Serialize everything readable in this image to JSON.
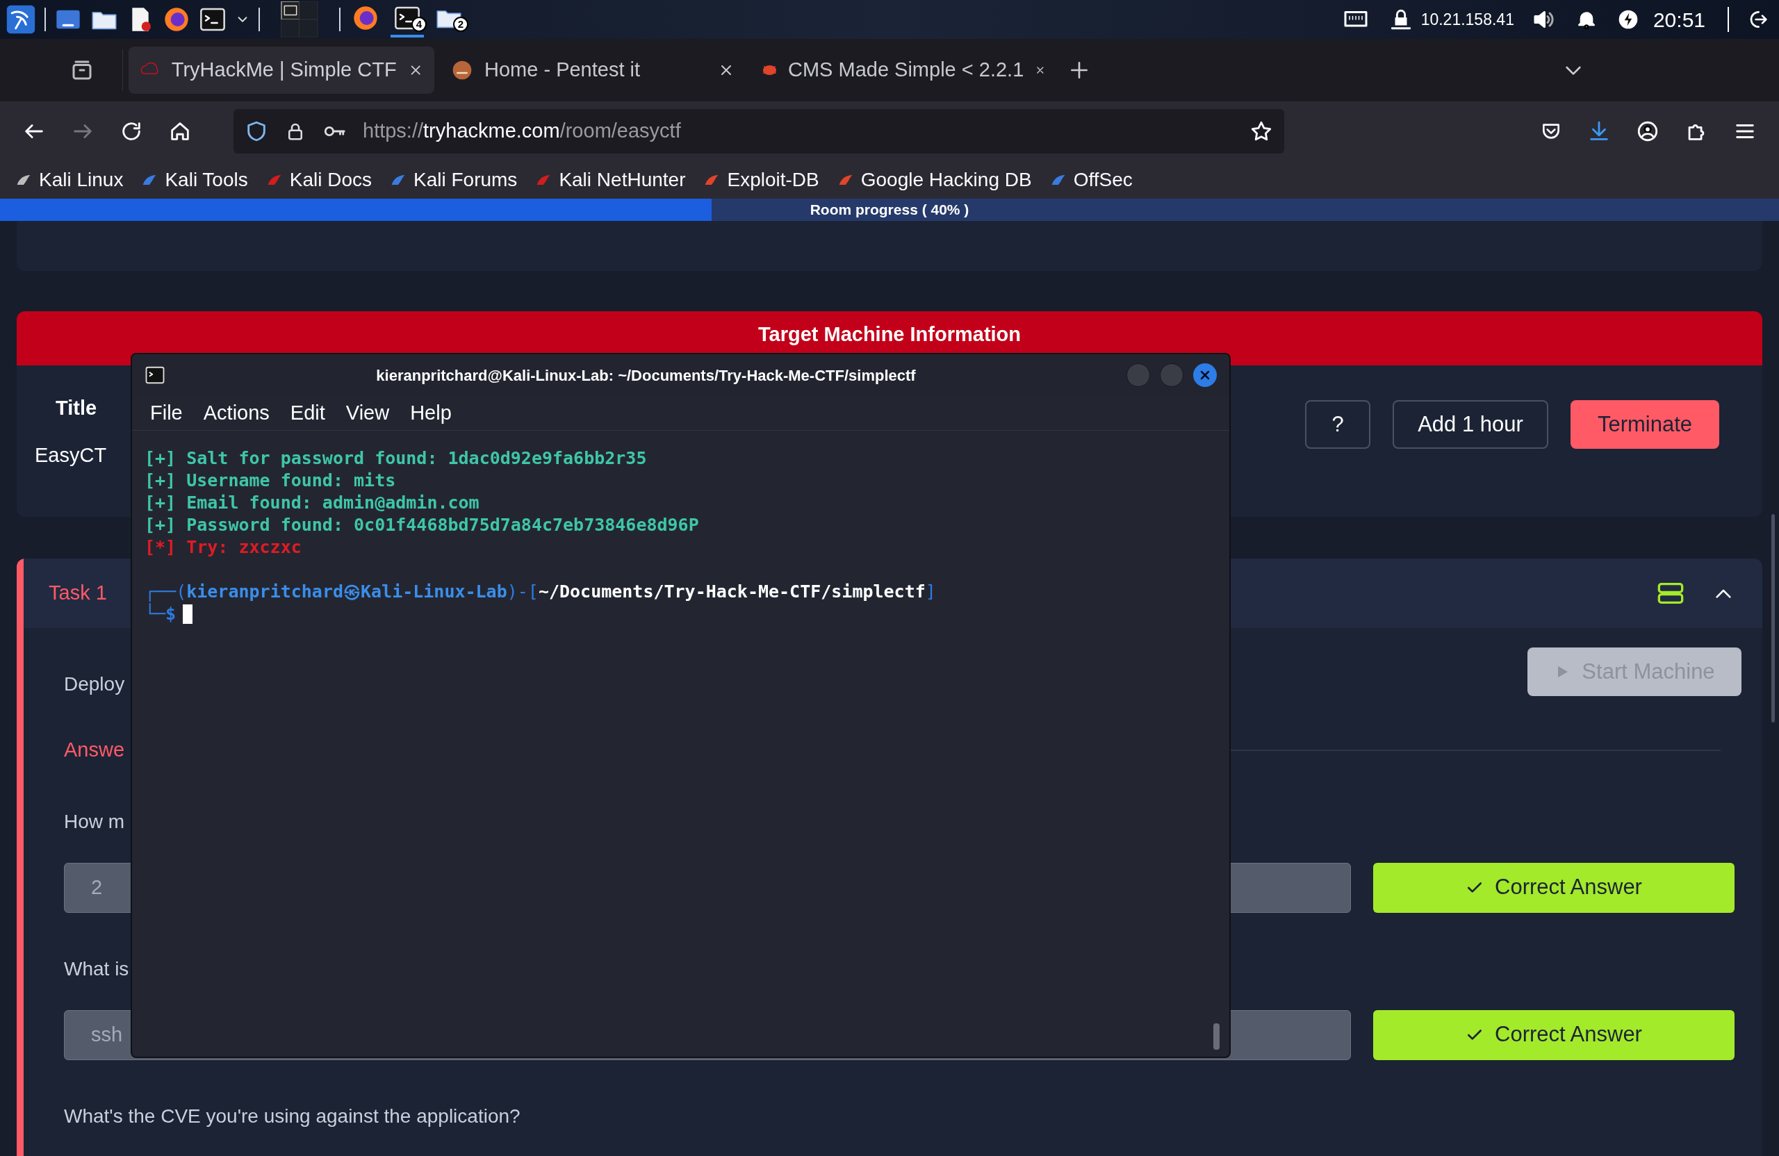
{
  "taskbar": {
    "running": [
      {
        "kind": "browser",
        "selected": false
      },
      {
        "kind": "terminal",
        "badge": "4",
        "selected": true
      },
      {
        "kind": "folder",
        "badge": "2",
        "selected": false
      }
    ],
    "ip": "10.21.158.41",
    "clock": "20:51"
  },
  "browser": {
    "tabs": [
      {
        "title": "TryHackMe | Simple CTF",
        "selected": true
      },
      {
        "title": "Home - Pentest it",
        "selected": false
      },
      {
        "title": "CMS Made Simple < 2.2.1",
        "selected": false
      }
    ],
    "url": {
      "scheme": "https://",
      "host": "tryhackme.com",
      "path": "/room/easyctf"
    },
    "bookmarks": [
      "Kali Linux",
      "Kali Tools",
      "Kali Docs",
      "Kali Forums",
      "Kali NetHunter",
      "Exploit-DB",
      "Google Hacking DB",
      "OffSec"
    ]
  },
  "progress": {
    "label": "Room progress ( 40% )",
    "level": 0.4
  },
  "target": {
    "header": "Target Machine Information",
    "column": "Title",
    "value": "EasyCT",
    "buttons": [
      "?",
      "Add 1 hour",
      "Terminate"
    ]
  },
  "task": {
    "label": "Task 1",
    "expanded": true,
    "start_button": {
      "label": "Start Machine",
      "disabled": true
    },
    "intro": "Deploy",
    "answer_heading": "Answe",
    "questions": [
      {
        "text": "How m",
        "answer": "2",
        "button": "Correct Answer"
      },
      {
        "text": "What is",
        "answer": "ssh",
        "button": "Correct Answer"
      },
      {
        "text": "What's the CVE you're using against the application?"
      }
    ]
  },
  "terminal": {
    "title": "kieranpritchard@Kali-Linux-Lab: ~/Documents/Try-Hack-Me-CTF/simplectf",
    "menu": [
      "File",
      "Actions",
      "Edit",
      "View",
      "Help"
    ],
    "lines": [
      {
        "kind": "found",
        "mark": "[+]",
        "text": "Salt for password found: 1dac0d92e9fa6bb2r35"
      },
      {
        "kind": "found",
        "mark": "[+]",
        "text": "Username found: mits"
      },
      {
        "kind": "found",
        "mark": "[+]",
        "text": "Email found: admin@admin.com"
      },
      {
        "kind": "found",
        "mark": "[+]",
        "text": "Password found: 0c01f4468bd75d7a84c7eb73846e8d96P"
      },
      {
        "kind": "try",
        "mark": "[*]",
        "text": "Try: zxczxc"
      }
    ],
    "prompt": {
      "open": "┌──(",
      "user": "kieranpritchard",
      "at": "㉿",
      "host": "Kali-Linux-Lab",
      "middle": ")-[",
      "path": "~/Documents/Try-Hack-Me-CTF/simplectf",
      "close": "]",
      "corner": "└─",
      "symbol": "$"
    }
  }
}
